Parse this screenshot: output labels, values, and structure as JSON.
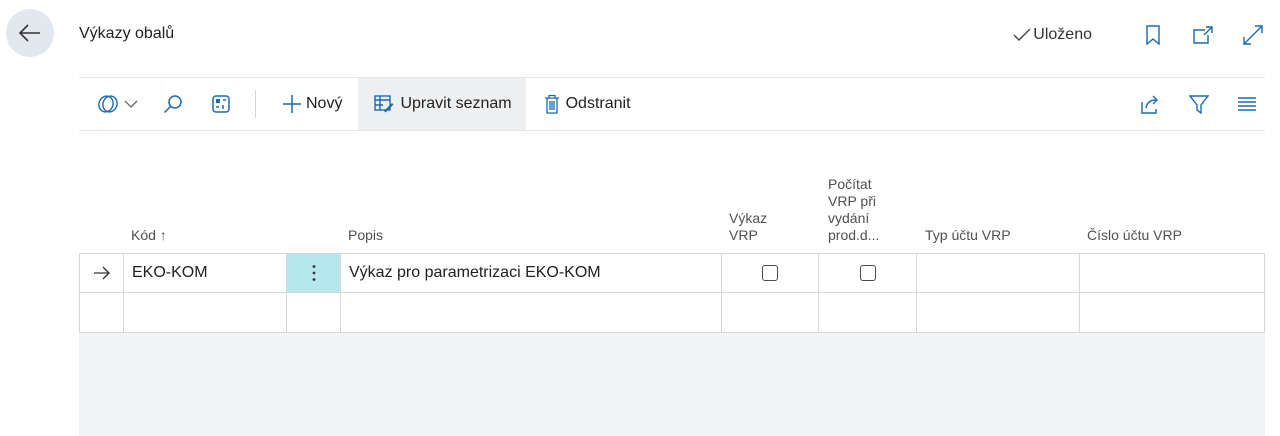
{
  "header": {
    "title": "Výkazy obalů",
    "saved_status": "Uloženo"
  },
  "toolbar": {
    "new_label": "Nový",
    "edit_list_label": "Upravit seznam",
    "delete_label": "Odstranit"
  },
  "table": {
    "columns": [
      {
        "label": "Kód ↑"
      },
      {
        "label": "Popis"
      },
      {
        "label": "Výkaz VRP"
      },
      {
        "label": "Počítat VRP při vydání prod.d..."
      },
      {
        "label": "Typ účtu VRP"
      },
      {
        "label": "Číslo účtu VRP"
      }
    ],
    "rows": [
      {
        "kod": "EKO-KOM",
        "popis": "Výkaz pro parametrizaci EKO-KOM",
        "vykaz_vrp": false,
        "pocitat_vrp": false,
        "typ_uctu": "",
        "cislo_uctu": ""
      },
      {
        "kod": "",
        "popis": "",
        "vykaz_vrp": null,
        "pocitat_vrp": null,
        "typ_uctu": "",
        "cislo_uctu": ""
      }
    ]
  },
  "colors": {
    "accent": "#1a6ab0",
    "selected_cell": "#b5e7ee",
    "back_button_bg": "#e3e8ef"
  }
}
